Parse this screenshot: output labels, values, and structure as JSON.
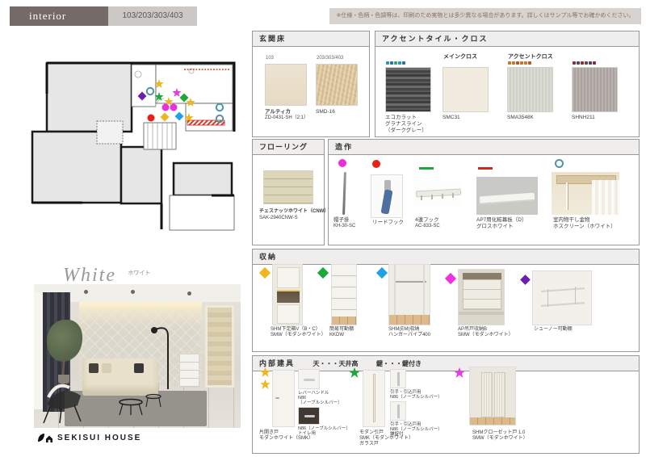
{
  "header": {
    "title": "interior",
    "units": "103/203/303/403",
    "disclaimer": "※仕様・色柄・色調等は、印刷のため実物とは多少異なる場合があります。詳しくはサンプル等でお確かめください。"
  },
  "photo": {
    "style": "White",
    "style_jp": "ホワイト",
    "brand": "SEKISUI HOUSE"
  },
  "sections": {
    "entrance": {
      "title": "玄関床",
      "item1": {
        "unit": "103",
        "name": "アルティカ",
        "code": "ZD-0431-SH（2:1）"
      },
      "item2": {
        "unit": "203/303/403",
        "name": "SMD-16"
      }
    },
    "accent": {
      "title": "アクセントタイル・クロス",
      "col1": {
        "l1": "エコカラット",
        "l2": "グラナスライン",
        "l3": "（ダークグレー）"
      },
      "col2": {
        "head": "メインクロス",
        "l1": "SMC31"
      },
      "col3": {
        "head": "アクセントクロス",
        "l1": "SMA3548K"
      },
      "col4": {
        "l1": "SHNH211"
      }
    },
    "flooring": {
      "title": "フローリング",
      "l1": "チェスナッツホワイト（CNW）",
      "l2": "SAK-2940CNW-S"
    },
    "fixtures": {
      "title": "造作",
      "i1": {
        "l1": "帽子掛",
        "l2": "KH-30-SC"
      },
      "i2": {
        "l1": "リードフック"
      },
      "i3": {
        "l1": "4連フック",
        "l2": "AC-833-SC"
      },
      "i4": {
        "l1": "AP7用化粧幕板（D）",
        "l2": "グロスホワイト"
      },
      "i5": {
        "l1": "室内物干し金物",
        "l2": "ホスクリーン（ホワイト）"
      }
    },
    "storage": {
      "title": "収納",
      "i1": {
        "l1": "SHM下足箱V（B・C）",
        "l2": "SMW（モダンホワイト）"
      },
      "i2": {
        "l1": "簡易可動棚",
        "l2": "KKDW"
      },
      "i3": {
        "l1": "SHM(EM)収納",
        "l2": "ハンガーパイプ400"
      },
      "i4": {
        "l1": "AP吊戸収納B",
        "l2": "SMW（モダンホワイト）"
      },
      "i5": {
        "l1": "シューノー可動棚"
      }
    },
    "fittings": {
      "title": "内部建具",
      "legend1": "天・・・天井高",
      "legend2": "鍵・・・鍵付き",
      "door1": {
        "l1": "片開き戸",
        "l2": "モダンホワイト（SMK）"
      },
      "handle1": {
        "l1": "レバーハンドル",
        "l2": "N86",
        "l3": "（ノーブルシルバー）"
      },
      "handle2": {
        "l1": "N86（ノーブルシルバー）",
        "l2": "トイレ用"
      },
      "door2": {
        "l1": "モダン引戸",
        "l2": "SMK（モダンホワイト）",
        "l3": "ガラス戸"
      },
      "pull1": {
        "l1": "引手・引込戸用",
        "l2": "N86（ノーブルシルバー）"
      },
      "pull2": {
        "l1": "引手・引込戸用",
        "l2": "N86（ノーブルシルバー）",
        "l3": "鎌錠付"
      },
      "door3": {
        "l1": "SHMクローゼット戸 1.0",
        "l2": "SMW（モダンホワイト）"
      }
    }
  },
  "colors": {
    "marker_gold": "#ecb71f",
    "marker_green": "#1ca83c",
    "marker_magenta": "#e23de2",
    "marker_purple": "#6a1fb0",
    "marker_cyan": "#22a2e6",
    "marker_red": "#e62218",
    "marker_teal": "#4f93a8",
    "accent_hatch_red": "#d43c2a"
  }
}
